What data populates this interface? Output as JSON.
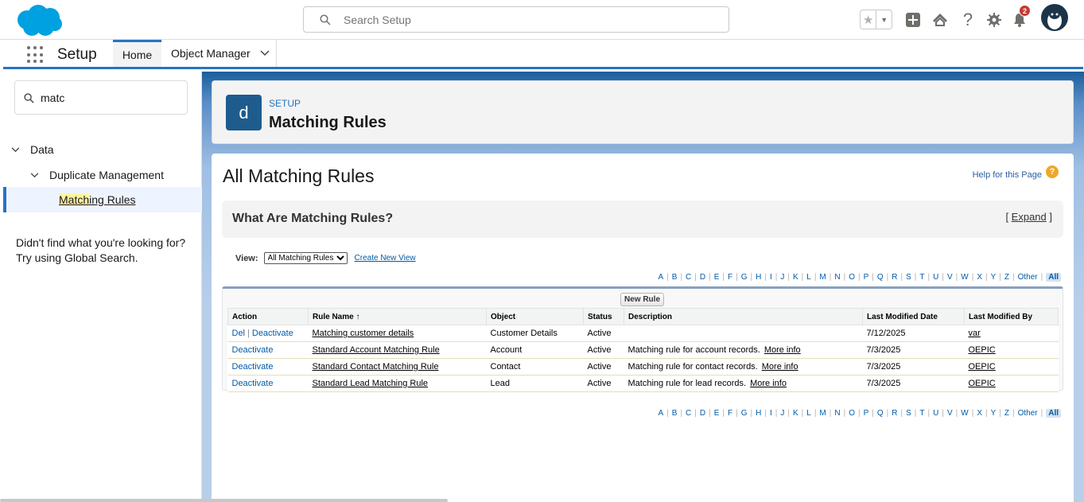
{
  "header": {
    "search_placeholder": "Search Setup",
    "notification_count": "2",
    "icons": [
      "salesforce-cloud-logo",
      "search-icon",
      "star-icon",
      "chevron-down-icon",
      "plus-icon",
      "trailhead-icon",
      "help-icon",
      "gear-icon",
      "bell-icon",
      "avatar"
    ]
  },
  "context_bar": {
    "app_name": "Setup",
    "tabs": [
      {
        "label": "Home",
        "active": true
      },
      {
        "label": "Object Manager",
        "active": false
      }
    ]
  },
  "sidebar": {
    "quick_find_value": "matc",
    "tree": {
      "data": "Data",
      "duplicate_management": "Duplicate Management",
      "matching_rules_highlight": "Match",
      "matching_rules_rest": "ing Rules"
    },
    "not_found": "Didn't find what you're looking for? Try using Global Search."
  },
  "page_header": {
    "icon_letter": "d",
    "eyebrow": "SETUP",
    "title": "Matching Rules"
  },
  "content": {
    "title": "All Matching Rules",
    "help_link": "Help for this Page",
    "info_title": "What Are Matching Rules?",
    "expand_label": "Expand",
    "view_label": "View:",
    "view_selected": "All Matching Rules",
    "create_view": "Create New View",
    "new_rule_button": "New Rule"
  },
  "alphabet": [
    "A",
    "B",
    "C",
    "D",
    "E",
    "F",
    "G",
    "H",
    "I",
    "J",
    "K",
    "L",
    "M",
    "N",
    "O",
    "P",
    "Q",
    "R",
    "S",
    "T",
    "U",
    "V",
    "W",
    "X",
    "Y",
    "Z",
    "Other",
    "All"
  ],
  "table": {
    "columns": [
      "Action",
      "Rule Name ↑",
      "Object",
      "Status",
      "Description",
      "Last Modified Date",
      "Last Modified By"
    ],
    "rows": [
      {
        "actions": [
          "Del",
          "Deactivate"
        ],
        "rule_name": "Matching customer details",
        "object": "Customer Details",
        "status": "Active",
        "description": "",
        "more": "",
        "date": "7/12/2025",
        "by": "var"
      },
      {
        "actions": [
          "Deactivate"
        ],
        "rule_name": "Standard Account Matching Rule",
        "object": "Account",
        "status": "Active",
        "description": "Matching rule for account records.",
        "more": "More info",
        "date": "7/3/2025",
        "by": "OEPIC"
      },
      {
        "actions": [
          "Deactivate"
        ],
        "rule_name": "Standard Contact Matching Rule",
        "object": "Contact",
        "status": "Active",
        "description": "Matching rule for contact records.",
        "more": "More info",
        "date": "7/3/2025",
        "by": "OEPIC"
      },
      {
        "actions": [
          "Deactivate"
        ],
        "rule_name": "Standard Lead Matching Rule",
        "object": "Lead",
        "status": "Active",
        "description": "Matching rule for lead records.",
        "more": "More info",
        "date": "7/3/2025",
        "by": "OEPIC"
      }
    ]
  },
  "colors": {
    "brand_blue": "#2574c4",
    "link_blue": "#015ba7",
    "header_icon_bg": "#1e5c8e",
    "notification_red": "#c23934"
  }
}
